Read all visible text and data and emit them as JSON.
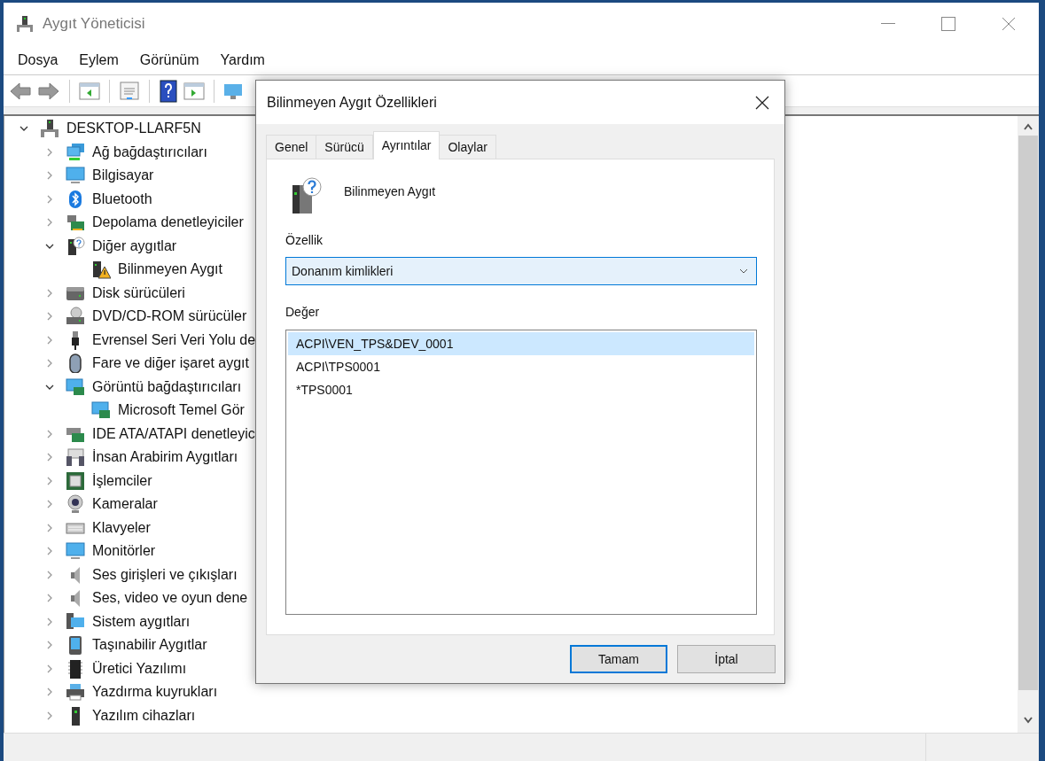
{
  "window": {
    "title": "Aygıt Yöneticisi"
  },
  "menu": [
    "Dosya",
    "Eylem",
    "Görünüm",
    "Yardım"
  ],
  "tree": {
    "label": "DESKTOP-LLARF5N",
    "expanded": true,
    "children": [
      {
        "label": "Ağ bağdaştırıcıları",
        "expanded": false
      },
      {
        "label": "Bilgisayar",
        "expanded": false
      },
      {
        "label": "Bluetooth",
        "expanded": false
      },
      {
        "label": "Depolama denetleyiciler",
        "expanded": false
      },
      {
        "label": "Diğer aygıtlar",
        "expanded": true,
        "children": [
          {
            "label": "Bilinmeyen Aygıt"
          }
        ]
      },
      {
        "label": "Disk sürücüleri",
        "expanded": false
      },
      {
        "label": "DVD/CD-ROM sürücüler",
        "expanded": false
      },
      {
        "label": "Evrensel Seri Veri Yolu de",
        "expanded": false
      },
      {
        "label": "Fare ve diğer işaret aygıt",
        "expanded": false
      },
      {
        "label": "Görüntü bağdaştırıcıları",
        "expanded": true,
        "children": [
          {
            "label": "Microsoft Temel Gör"
          }
        ]
      },
      {
        "label": "IDE ATA/ATAPI denetleyic",
        "expanded": false
      },
      {
        "label": "İnsan Arabirim Aygıtları",
        "expanded": false
      },
      {
        "label": "İşlemciler",
        "expanded": false
      },
      {
        "label": "Kameralar",
        "expanded": false
      },
      {
        "label": "Klavyeler",
        "expanded": false
      },
      {
        "label": "Monitörler",
        "expanded": false
      },
      {
        "label": "Ses girişleri ve çıkışları",
        "expanded": false
      },
      {
        "label": "Ses, video ve oyun dene",
        "expanded": false
      },
      {
        "label": "Sistem aygıtları",
        "expanded": false
      },
      {
        "label": "Taşınabilir Aygıtlar",
        "expanded": false
      },
      {
        "label": "Üretici Yazılımı",
        "expanded": false
      },
      {
        "label": "Yazdırma kuyrukları",
        "expanded": false
      },
      {
        "label": "Yazılım cihazları",
        "expanded": false
      }
    ]
  },
  "dialog": {
    "title": "Bilinmeyen Aygıt Özellikleri",
    "tabs": [
      {
        "label": "Genel",
        "selected": false
      },
      {
        "label": "Sürücü",
        "selected": false
      },
      {
        "label": "Ayrıntılar",
        "selected": true
      },
      {
        "label": "Olaylar",
        "selected": false
      }
    ],
    "device_name": "Bilinmeyen Aygıt",
    "property_label": "Özellik",
    "property_value": "Donanım kimlikleri",
    "value_label": "Değer",
    "values": [
      {
        "text": "ACPI\\VEN_TPS&DEV_0001",
        "selected": true
      },
      {
        "text": "ACPI\\TPS0001",
        "selected": false
      },
      {
        "text": "*TPS0001",
        "selected": false
      }
    ],
    "buttons": [
      "Tamam",
      "İptal"
    ]
  }
}
